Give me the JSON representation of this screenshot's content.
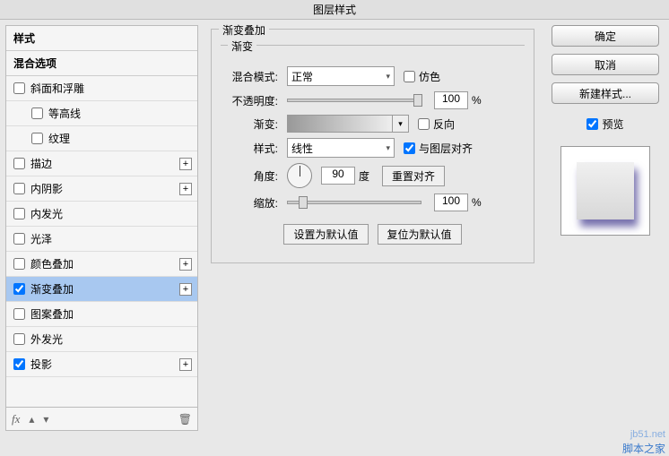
{
  "title": "图层样式",
  "sidebar": {
    "header_styles": "样式",
    "header_blend": "混合选项",
    "items": [
      {
        "label": "斜面和浮雕",
        "checked": false,
        "plus": false,
        "indent": false
      },
      {
        "label": "等高线",
        "checked": false,
        "plus": false,
        "indent": true
      },
      {
        "label": "纹理",
        "checked": false,
        "plus": false,
        "indent": true
      },
      {
        "label": "描边",
        "checked": false,
        "plus": true,
        "indent": false
      },
      {
        "label": "内阴影",
        "checked": false,
        "plus": true,
        "indent": false
      },
      {
        "label": "内发光",
        "checked": false,
        "plus": false,
        "indent": false
      },
      {
        "label": "光泽",
        "checked": false,
        "plus": false,
        "indent": false
      },
      {
        "label": "颜色叠加",
        "checked": false,
        "plus": true,
        "indent": false
      },
      {
        "label": "渐变叠加",
        "checked": true,
        "plus": true,
        "indent": false,
        "selected": true
      },
      {
        "label": "图案叠加",
        "checked": false,
        "plus": false,
        "indent": false
      },
      {
        "label": "外发光",
        "checked": false,
        "plus": false,
        "indent": false
      },
      {
        "label": "投影",
        "checked": true,
        "plus": true,
        "indent": false
      }
    ],
    "footer_fx": "fx"
  },
  "panel": {
    "title": "渐变叠加",
    "subtitle": "渐变",
    "blend_label": "混合模式:",
    "blend_value": "正常",
    "dither_label": "仿色",
    "opacity_label": "不透明度:",
    "opacity_value": "100",
    "percent": "%",
    "gradient_label": "渐变:",
    "reverse_label": "反向",
    "style_label": "样式:",
    "style_value": "线性",
    "align_label": "与图层对齐",
    "angle_label": "角度:",
    "angle_value": "90",
    "degree": "度",
    "reset_align": "重置对齐",
    "scale_label": "缩放:",
    "scale_value": "100",
    "make_default": "设置为默认值",
    "reset_default": "复位为默认值"
  },
  "buttons": {
    "ok": "确定",
    "cancel": "取消",
    "new_style": "新建样式...",
    "preview": "预览"
  },
  "watermark": {
    "url": "jb51.net",
    "text": "脚本之家"
  }
}
